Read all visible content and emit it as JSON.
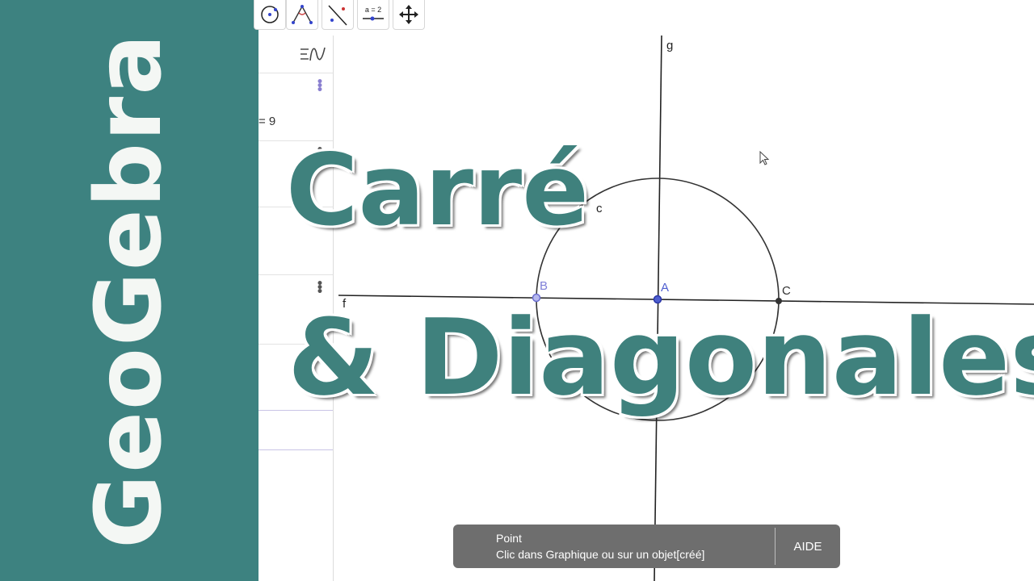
{
  "sidebar": {
    "brand_text": "GeoGebra",
    "color": "#3d8280"
  },
  "toolbar": {
    "tools": [
      {
        "icon": "circle-tool-icon"
      },
      {
        "icon": "angle-tool-icon"
      },
      {
        "icon": "reflect-line-tool-icon"
      },
      {
        "icon": "slider-tool-icon",
        "label": "a = 2"
      },
      {
        "icon": "move-graphics-tool-icon"
      }
    ]
  },
  "algebra": {
    "menu_icon": "algebra-view-menu-icon",
    "visible_value": "= 9"
  },
  "graphics": {
    "axis_labels": {
      "vertical": "g",
      "horizontal": "f"
    },
    "circle_label": "c",
    "points": [
      {
        "name": "B",
        "color": "#7f7fd8"
      },
      {
        "name": "A",
        "color": "#4f5fd0"
      },
      {
        "name": "C",
        "color": "#333333"
      }
    ]
  },
  "overlay": {
    "title_line1": "Carré",
    "title_line2": "& Diagonales",
    "title_color": "#3f817d"
  },
  "status": {
    "tool_name": "Point",
    "hint": "Clic dans Graphique ou sur un objet[créé]",
    "help_label": "AIDE"
  }
}
